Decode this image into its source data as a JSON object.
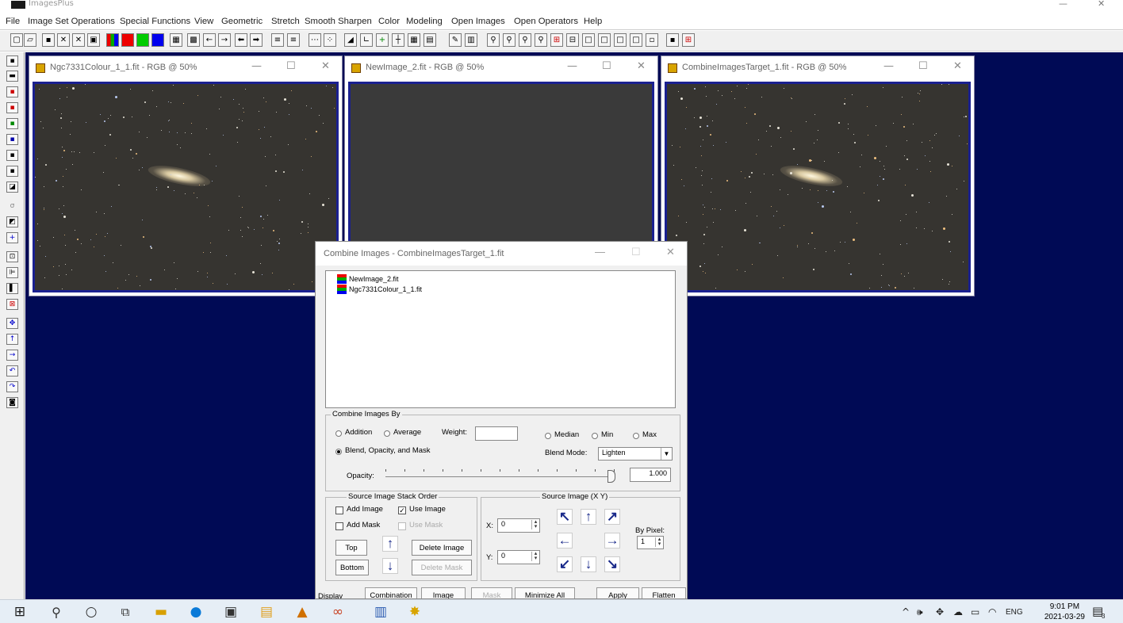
{
  "app": {
    "title": "ImagesPlus"
  },
  "menu": [
    "File",
    "Image Set Operations",
    "Special Functions",
    "View",
    "Geometric",
    "Stretch",
    "Smooth Sharpen",
    "Color",
    "Modeling",
    "Open Images",
    "Open Operators",
    "Help"
  ],
  "windows": [
    {
      "title": "Ngc7331Colour_1_1.fit - RGB @ 50%"
    },
    {
      "title": "NewImage_2.fit - RGB @ 50%"
    },
    {
      "title": "CombineImagesTarget_1.fit - RGB @ 50%"
    }
  ],
  "window_controls": {
    "minimize": "—",
    "maximize": "☐",
    "close": "✕"
  },
  "dialog": {
    "title": "Combine Images - CombineImagesTarget_1.fit",
    "images": [
      "NewImage_2.fit",
      "Ngc7331Colour_1_1.fit"
    ],
    "combine_group": "Combine Images By",
    "addition": "Addition",
    "average": "Average",
    "weight": "Weight:",
    "median": "Median",
    "min": "Min",
    "max": "Max",
    "blend": "Blend, Opacity, and Mask",
    "blend_mode_label": "Blend Mode:",
    "blend_mode_value": "Lighten",
    "opacity_label": "Opacity:",
    "opacity_value": "1.000",
    "stack_group": "Source Image Stack Order",
    "add_image": "Add Image",
    "use_image": "Use Image",
    "add_mask": "Add Mask",
    "use_mask": "Use Mask",
    "top": "Top",
    "bottom": "Bottom",
    "delete_image": "Delete Image",
    "delete_mask": "Delete Mask",
    "source_group": "Source Image (X Y)",
    "x_label": "X:",
    "y_label": "Y:",
    "x_value": "0",
    "y_value": "0",
    "by_pixel": "By Pixel:",
    "by_pixel_value": "1",
    "bottom_buttons": [
      "Combination",
      "Image",
      "Mask",
      "Minimize All",
      "Apply",
      "Flatten"
    ],
    "display_label": "Display"
  },
  "taskbar": {
    "time": "9:01 PM",
    "date": "2021-03-29",
    "lang": "ENG",
    "notif": "3"
  }
}
